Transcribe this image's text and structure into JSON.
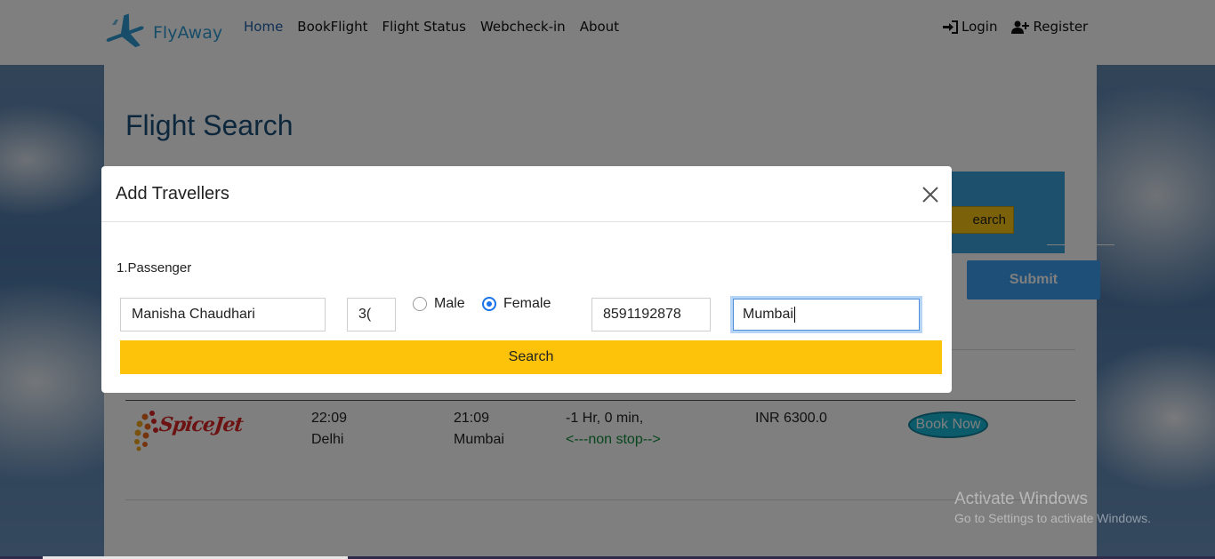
{
  "navbar": {
    "brand": "FlyAway",
    "links": [
      "Home",
      "BookFlight",
      "Flight Status",
      "Webcheck-in",
      "About"
    ],
    "login": "Login",
    "register": "Register"
  },
  "page": {
    "title": "Flight Search",
    "band_button": "earch",
    "submit": "Submit"
  },
  "result": {
    "airline": "SpiceJet",
    "depart_time": "22:09",
    "depart_city": "Delhi",
    "arrive_time": "21:09",
    "arrive_city": "Mumbai",
    "duration": "-1 Hr, 0 min,",
    "stops": "<---non stop-->",
    "price": "INR 6300.0",
    "book": "Book Now"
  },
  "modal": {
    "title": "Add Travellers",
    "passenger_label": "1.Passenger",
    "name_value": "Manisha Chaudhari",
    "age_value": "3(",
    "gender_options": [
      "Male",
      "Female"
    ],
    "gender_selected": "Female",
    "phone_value": "8591192878",
    "city_value": "Mumbai",
    "search": "Search"
  },
  "watermark": {
    "title": "Activate Windows",
    "subtitle": "Go to Settings to activate Windows."
  },
  "colors": {
    "brand": "#2f9ad3",
    "search_button": "#fdc20a",
    "submit_button": "#3b9ef0",
    "radio_checked": "#1a73e8"
  }
}
